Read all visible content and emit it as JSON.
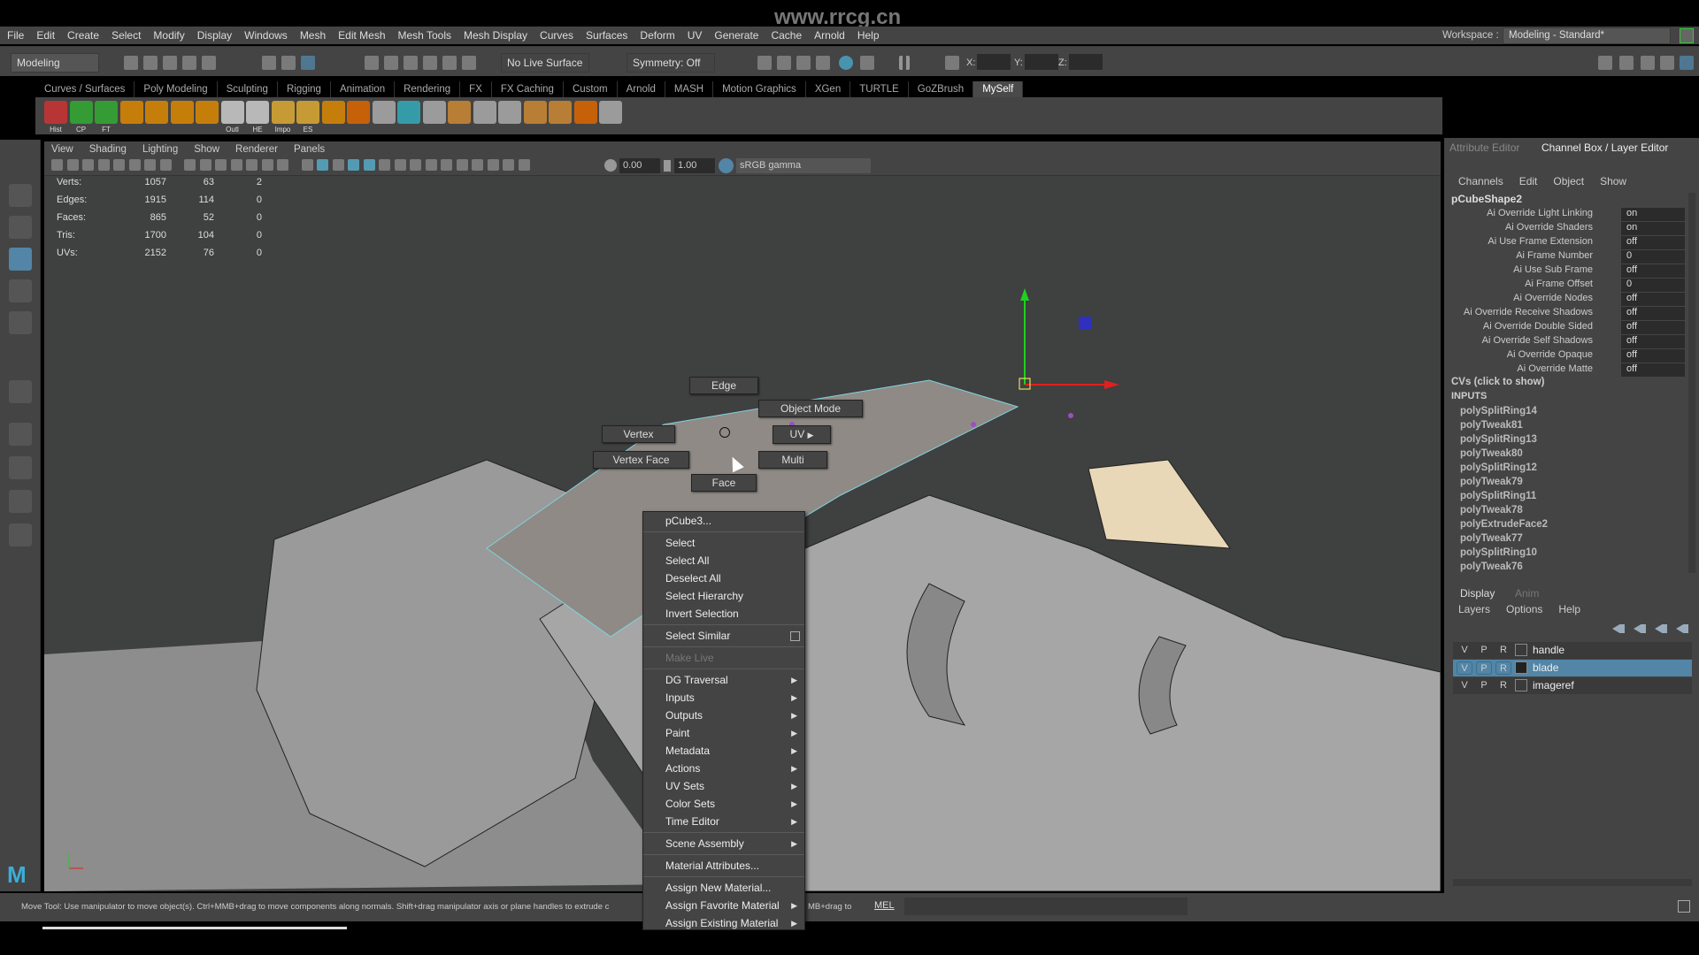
{
  "watermark": "www.rrcg.cn",
  "menubar": [
    "File",
    "Edit",
    "Create",
    "Select",
    "Modify",
    "Display",
    "Windows",
    "Mesh",
    "Edit Mesh",
    "Mesh Tools",
    "Mesh Display",
    "Curves",
    "Surfaces",
    "Deform",
    "UV",
    "Generate",
    "Cache",
    "Arnold",
    "Help"
  ],
  "status": {
    "mode": "Modeling",
    "live_surface": "No Live Surface",
    "symmetry": "Symmetry: Off",
    "x_label": "X:",
    "y_label": "Y:",
    "z_label": "Z:",
    "workspace_label": "Workspace :",
    "workspace": "Modeling - Standard*"
  },
  "shelf_tabs": [
    "Curves / Surfaces",
    "Poly Modeling",
    "Sculpting",
    "Rigging",
    "Animation",
    "Rendering",
    "FX",
    "FX Caching",
    "Custom",
    "Arnold",
    "MASH",
    "Motion Graphics",
    "XGen",
    "TURTLE",
    "GoZBrush",
    "MySelf"
  ],
  "shelf_active": "MySelf",
  "shelf_labels": [
    "Hist",
    "CP",
    "FT",
    "Outl",
    "HE",
    "Impo",
    "ES"
  ],
  "viewport": {
    "menu": [
      "View",
      "Shading",
      "Lighting",
      "Show",
      "Renderer",
      "Panels"
    ],
    "exposure": "0.00",
    "gamma": "1.00",
    "colorspace": "sRGB gamma",
    "hud": [
      {
        "label": "Verts:",
        "a": "1057",
        "b": "63",
        "c": "2"
      },
      {
        "label": "Edges:",
        "a": "1915",
        "b": "114",
        "c": "0"
      },
      {
        "label": "Faces:",
        "a": "865",
        "b": "52",
        "c": "0"
      },
      {
        "label": "Tris:",
        "a": "1700",
        "b": "104",
        "c": "0"
      },
      {
        "label": "UVs:",
        "a": "2152",
        "b": "76",
        "c": "0"
      }
    ]
  },
  "marking_menu": {
    "edge": "Edge",
    "object_mode": "Object Mode",
    "vertex": "Vertex",
    "uv": "UV",
    "vertex_face": "Vertex Face",
    "multi": "Multi",
    "face": "Face"
  },
  "context_menu": {
    "title": "pCube3...",
    "items": [
      {
        "label": "Select"
      },
      {
        "label": "Select All"
      },
      {
        "label": "Deselect All"
      },
      {
        "label": "Select Hierarchy"
      },
      {
        "label": "Invert Selection"
      }
    ],
    "similar": "Select Similar",
    "make_live": "Make Live",
    "sub": [
      "DG Traversal",
      "Inputs",
      "Outputs",
      "Paint",
      "Metadata",
      "Actions",
      "UV Sets",
      "Color Sets",
      "Time Editor"
    ],
    "scene_assembly": "Scene Assembly",
    "material_attributes": "Material Attributes...",
    "assign_new": "Assign New Material...",
    "assign_fav": "Assign Favorite Material",
    "assign_existing": "Assign Existing Material"
  },
  "right_panel": {
    "tab_attr": "Attribute Editor",
    "tab_channel": "Channel Box / Layer Editor",
    "cb_menu": [
      "Channels",
      "Edit",
      "Object",
      "Show"
    ],
    "object": "pCubeShape2",
    "attrs": [
      {
        "name": "Ai Override Light Linking",
        "value": "on"
      },
      {
        "name": "Ai Override Shaders",
        "value": "on"
      },
      {
        "name": "Ai Use Frame Extension",
        "value": "off"
      },
      {
        "name": "Ai Frame Number",
        "value": "0"
      },
      {
        "name": "Ai Use Sub Frame",
        "value": "off"
      },
      {
        "name": "Ai Frame Offset",
        "value": "0"
      },
      {
        "name": "Ai Override Nodes",
        "value": "off"
      },
      {
        "name": "Ai Override Receive Shadows",
        "value": "off"
      },
      {
        "name": "Ai Override Double Sided",
        "value": "off"
      },
      {
        "name": "Ai Override Self Shadows",
        "value": "off"
      },
      {
        "name": "Ai Override Opaque",
        "value": "off"
      },
      {
        "name": "Ai Override Matte",
        "value": "off"
      }
    ],
    "cvs": "CVs (click to show)",
    "inputs_label": "INPUTS",
    "inputs": [
      "polySplitRing14",
      "polyTweak81",
      "polySplitRing13",
      "polyTweak80",
      "polySplitRing12",
      "polyTweak79",
      "polySplitRing11",
      "polyTweak78",
      "polyExtrudeFace2",
      "polyTweak77",
      "polySplitRing10",
      "polyTweak76"
    ],
    "layer_tabs": [
      "Display",
      "Anim"
    ],
    "layer_menu": [
      "Layers",
      "Options",
      "Help"
    ],
    "vpr": [
      "V",
      "P",
      "R"
    ],
    "layers": [
      {
        "name": "handle",
        "selected": false
      },
      {
        "name": "blade",
        "selected": true
      },
      {
        "name": "imageref",
        "selected": false
      }
    ]
  },
  "helpline": "Move Tool: Use manipulator to move object(s). Ctrl+MMB+drag to move components along normals. Shift+drag manipulator axis or plane handles to extrude c",
  "helpline_tail": "MB+drag to",
  "mel": "MEL",
  "colors": {
    "selection": "#5285a6",
    "wire": "#7fd4e0",
    "component": "#9b4fc1",
    "x_axis": "#e02020",
    "y_axis": "#20d020",
    "z_axis": "#3030c0"
  }
}
